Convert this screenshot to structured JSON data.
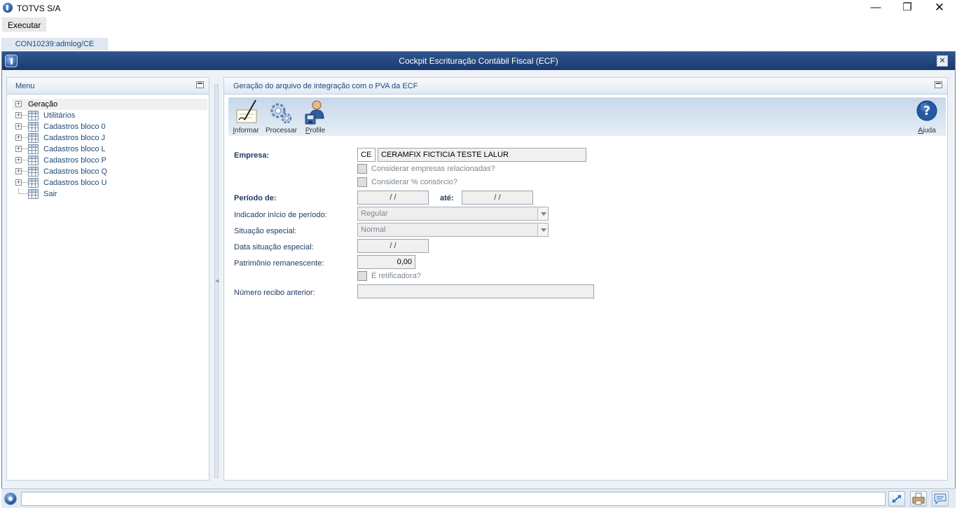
{
  "app": {
    "title": "TOTVS S/A",
    "min": "—",
    "max": "❐",
    "close": "✕"
  },
  "menubar": {
    "executar": "Executar"
  },
  "tabs": [
    {
      "label": "CON10239:admlog/CE"
    }
  ],
  "dialog": {
    "title": "Cockpit Escrituração Contábil Fiscal (ECF)",
    "close": "✕"
  },
  "menu_panel": {
    "title": "Menu",
    "items": [
      {
        "label": "Geração",
        "selected": true
      },
      {
        "label": "Utilitários"
      },
      {
        "label": "Cadastros bloco 0"
      },
      {
        "label": "Cadastros bloco J"
      },
      {
        "label": "Cadastros bloco L"
      },
      {
        "label": "Cadastros bloco P"
      },
      {
        "label": "Cadastros bloco Q"
      },
      {
        "label": "Cadastros bloco U"
      },
      {
        "label": "Sair"
      }
    ]
  },
  "main_panel": {
    "title": "Geração do arquivo de integração com o PVA da ECF",
    "toolbar": {
      "informar_first": "I",
      "informar_rest": "nformar",
      "processar": "Processar",
      "profile_first": "P",
      "profile_rest": "rofile",
      "ajuda_first": "A",
      "ajuda_rest": "juda"
    }
  },
  "form": {
    "empresa_label": "Empresa:",
    "empresa_code": "CE",
    "empresa_name": "CERAMFIX FICTICIA TESTE LALUR",
    "considerar_relacionadas": "Considerar empresas relacionadas?",
    "considerar_consorcio": "Considerar % consórcio?",
    "periodo_label": "Período de:",
    "periodo_de": " / /",
    "ate_label": "até:",
    "periodo_ate": " / /",
    "indicador_label": "Indicador início de período:",
    "indicador_value": "Regular",
    "situacao_label": "Situação especial:",
    "situacao_value": "Normal",
    "data_situacao_label": "Data situação especial:",
    "data_situacao_value": " / /",
    "patrimonio_label": "Patrimônio remanescente:",
    "patrimonio_value": "0,00",
    "retificadora": "É retificadora?",
    "recibo_label": "Número recibo anterior:",
    "recibo_value": ""
  },
  "colors": {
    "header_blue": "#1b3a6b",
    "link_blue": "#1f4a78"
  }
}
